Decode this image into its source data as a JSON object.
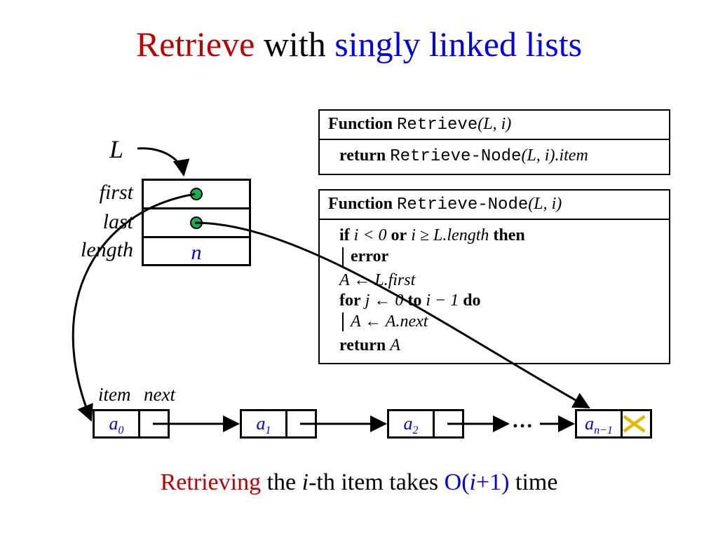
{
  "title": {
    "part1": "Retrieve",
    "part2": " with ",
    "part3": "singly linked lists"
  },
  "listLabel": "L",
  "record": {
    "labels": {
      "first": "first",
      "last": "last",
      "length": "length"
    },
    "lengthValue": "n"
  },
  "func1": {
    "kw": "Function",
    "name": "Retrieve",
    "args": "(L, i)",
    "ret_kw": "return",
    "ret_call": "Retrieve-Node",
    "ret_args": "(L, i)",
    "ret_field": ".item"
  },
  "func2": {
    "kw": "Function",
    "name": "Retrieve-Node",
    "args": "(L, i)",
    "l1_if": "if",
    "l1_cond1": "i < 0",
    "l1_or": "or",
    "l1_cond2": "i ≥ L.length",
    "l1_then": "then",
    "l1_err": "error",
    "l2": "A ← L.first",
    "l3_for": "for",
    "l3_j": "j ← 0",
    "l3_to": "to",
    "l3_end": "i − 1",
    "l3_do": "do",
    "l3_body": "A ← A.next",
    "l4_ret": "return",
    "l4_val": "A"
  },
  "nodeLabels": {
    "item": "item",
    "next": "next"
  },
  "nodes": {
    "a0": "a",
    "a0_sub": "0",
    "a1": "a",
    "a1_sub": "1",
    "a2": "a",
    "a2_sub": "2",
    "an": "a",
    "an_sub": "n−1"
  },
  "ellipsis": "…",
  "summary": {
    "s1": "Retrieving",
    "s2": " the ",
    "s3": "i",
    "s4": "-th item takes ",
    "s5_open": "O(",
    "s5_mid": "i",
    "s5_plus": "+1)",
    "s6": " time"
  }
}
